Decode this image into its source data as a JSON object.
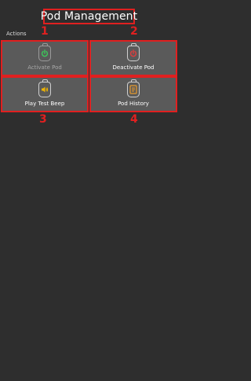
{
  "header": {
    "title": "Pod Management"
  },
  "section": {
    "label": "Actions"
  },
  "annotations": [
    "1",
    "2",
    "3",
    "4"
  ],
  "tiles": [
    {
      "label": "Activate Pod",
      "icon": "power-icon",
      "color": "#3cc85a",
      "enabled": false
    },
    {
      "label": "Deactivate Pod",
      "icon": "power-icon",
      "color": "#e03c3c",
      "enabled": true
    },
    {
      "label": "Play Test Beep",
      "icon": "speaker-icon",
      "color": "#f0b400",
      "enabled": true
    },
    {
      "label": "Pod History",
      "icon": "history-icon",
      "color": "#e89a2c",
      "enabled": true
    }
  ]
}
